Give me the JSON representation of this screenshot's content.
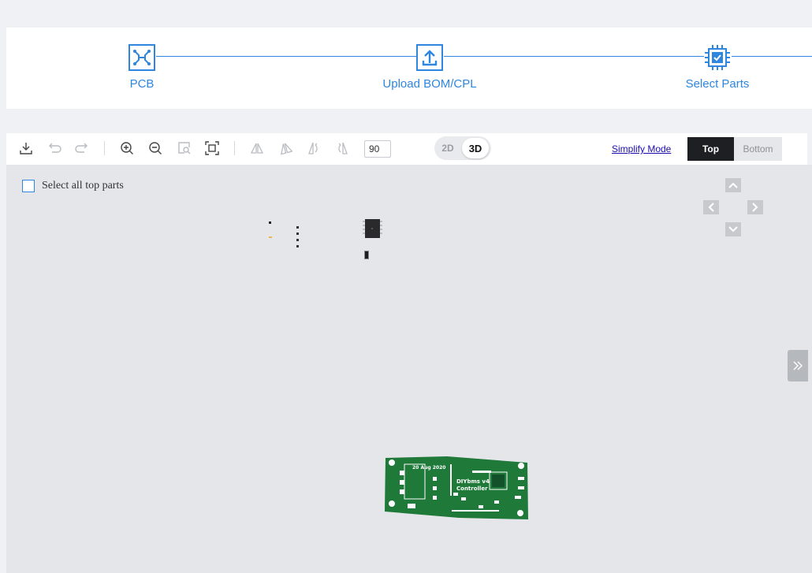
{
  "steps": [
    {
      "label": "PCB",
      "icon": "pcb-icon"
    },
    {
      "label": "Upload BOM/CPL",
      "icon": "upload-icon"
    },
    {
      "label": "Select Parts",
      "icon": "chip-check-icon"
    }
  ],
  "toolbar": {
    "icons": [
      "download-icon",
      "undo-icon",
      "redo-icon",
      "zoom-in-icon",
      "zoom-out-icon",
      "zoom-area-icon",
      "fit-screen-icon",
      "flip-horizontal-icon",
      "flip-vertical-icon",
      "rotate-left-icon",
      "rotate-right-icon"
    ],
    "rotation_value": "90",
    "view_2d": "2D",
    "view_3d": "3D",
    "active_view": "3D",
    "simplify_mode": "Simplify Mode",
    "side_top": "Top",
    "side_bottom": "Bottom",
    "active_side": "Top"
  },
  "canvas": {
    "select_all_label": "Select all top parts",
    "pan_controls": [
      "pan-up-icon",
      "pan-left-icon",
      "pan-right-icon",
      "pan-down-icon"
    ],
    "expand_icon": "double-chevron-right-icon",
    "pcb_texts": [
      "20 Aug 2020",
      "DIYbms v4",
      "Controller"
    ]
  },
  "colors": {
    "accent": "#2f86de",
    "pcb_green": "#1f7a3a",
    "dark": "#1e1f22",
    "canvas_bg": "#e5e6e9"
  }
}
